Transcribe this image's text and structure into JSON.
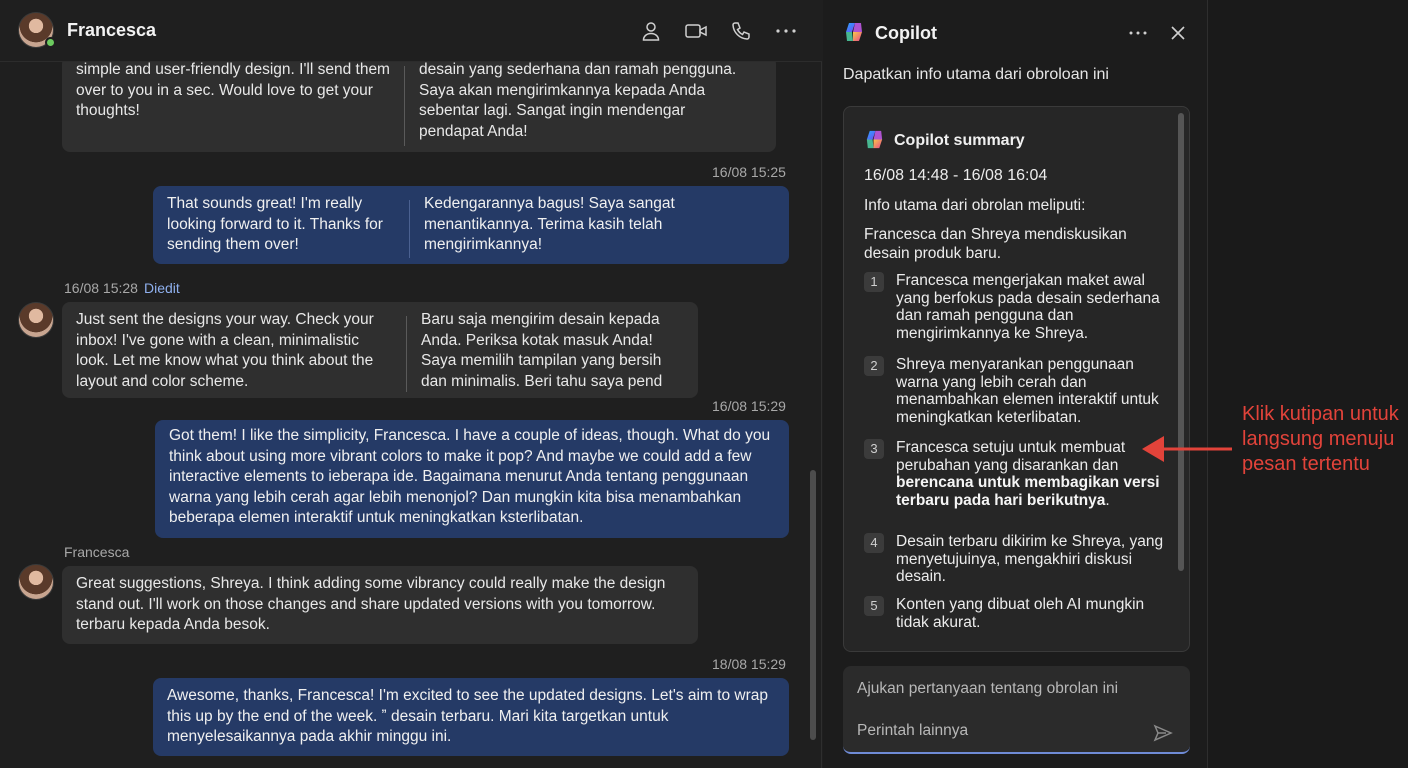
{
  "chat": {
    "contact_name": "Francesca",
    "messages": [
      {
        "id": "m1",
        "en": "simple and user-friendly design. I'll send them over to you in a sec. Would love to get your thoughts!",
        "id_text": "desain yang sederhana dan ramah pengguna. Saya akan mengirimkannya kepada Anda sebentar lagi. Sangat ingin mendengar pendapat Anda!"
      },
      {
        "id": "m2",
        "time": "16/08 15:25",
        "en": "That sounds great! I'm really looking forward to it. Thanks for sending them over!",
        "id_text": "Kedengarannya bagus! Saya sangat menantikannya. Terima kasih telah mengirimkannya!"
      },
      {
        "id": "m3",
        "time": "16/08 15:28",
        "edited": "Diedit",
        "en": "Just sent the designs your way. Check your inbox! I've gone with a clean, minimalistic look. Let me know what you think about the layout and color scheme.",
        "id_text": "Baru saja mengirim desain kepada Anda. Periksa kotak masuk Anda! Saya memilih tampilan yang bersih dan minimalis. Beri tahu saya pend"
      },
      {
        "id": "m4",
        "time": "16/08 15:29",
        "text": "Got them! I like the simplicity, Francesca. I have a couple of ideas, though. What do you think about using more vibrant colors to make it pop? And maybe we could add a few interactive elements to ieberapa ide. Bagaimana menurut Anda tentang penggunaan warna yang lebih cerah agar lebih menonjol? Dan mungkin kita bisa menambahkan beberapa elemen interaktif untuk meningkatkan ksterlibatan."
      },
      {
        "id": "m5",
        "sender": "Francesca",
        "text": "Great suggestions, Shreya. I think adding some vibrancy could really make the design stand out. I'll work on those changes and share updated versions with you tomorrow. terbaru kepada Anda besok."
      },
      {
        "id": "m6",
        "time": "18/08 15:29",
        "text": "Awesome, thanks, Francesca! I'm excited to see the updated designs. Let's aim to wrap this up by the end of the week. ˮ desain terbaru. Mari kita targetkan untuk menyelesaikannya pada akhir minggu ini."
      }
    ]
  },
  "copilot": {
    "title": "Copilot",
    "prompt": "Dapatkan info utama dari obroloan ini",
    "summary_title": "Copilot summary",
    "date_range": "16/08 14:48 - 16/08 16:04",
    "intro": "Info utama dari obrolan meliputi:",
    "lead": "Francesca dan Shreya mendiskusikan desain produk baru.",
    "points": [
      {
        "n": "1",
        "text": "Francesca mengerjakan maket awal yang berfokus pada desain sederhana dan ramah pengguna dan mengirimkannya ke Shreya."
      },
      {
        "n": "2",
        "text": "Shreya menyarankan penggunaan warna yang lebih cerah dan menambahkan elemen interaktif untuk meningkatkan keterlibatan."
      },
      {
        "n": "3",
        "text_plain": "Francesca setuju untuk membuat perubahan yang disarankan dan ",
        "text_bold": "berencana untuk membagikan versi terbaru pada hari berikutnya",
        "text_end": "."
      },
      {
        "n": "4",
        "text": "Desain terbaru dikirim ke Shreya, yang menyetujuinya, mengakhiri diskusi desain."
      },
      {
        "n": "5",
        "text": "Konten yang dibuat oleh AI mungkin tidak akurat."
      }
    ],
    "ask_placeholder": "Ajukan pertanyaan tentang obrolan ini",
    "more_prompts": "Perintah lainnya"
  },
  "annotation": {
    "text": "Klik kutipan untuk langsung menuju pesan tertentu",
    "color": "#e2433a"
  },
  "colors": {
    "sent_bubble": "#253a66",
    "received_bubble": "#2f2f2f",
    "presence": "#6ccb5f"
  }
}
